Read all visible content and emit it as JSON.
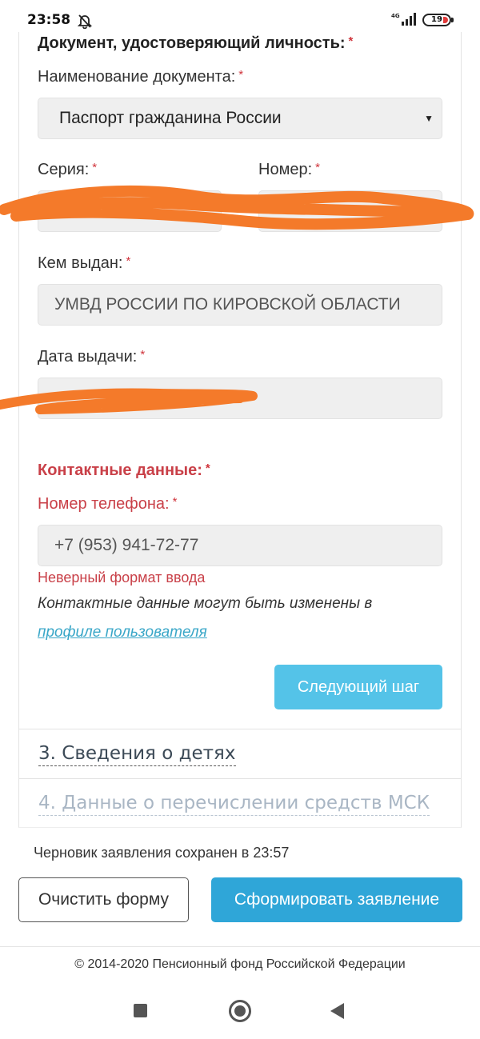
{
  "status_bar": {
    "time": "23:58",
    "network": "4G",
    "battery": "19"
  },
  "identity": {
    "section_title": "Документ, удостоверяющий личность:",
    "doc_name_label": "Наименование документа:",
    "doc_name_value": "Паспорт гражданина России",
    "series_label": "Серия:",
    "series_value": "",
    "number_label": "Номер:",
    "number_value": "",
    "issued_by_label": "Кем выдан:",
    "issued_by_value": "УМВД РОССИИ ПО КИРОВСКОЙ ОБЛАСТИ",
    "issue_date_label": "Дата выдачи:",
    "issue_date_value": ""
  },
  "contacts": {
    "section_title": "Контактные данные:",
    "phone_label": "Номер телефона:",
    "phone_value": "+7 (953) 941-72-77",
    "error": "Неверный формат ввода",
    "note": "Контактные данные могут быть изменены в",
    "note_link": "профиле пользователя",
    "next_button": "Следующий шаг"
  },
  "required_mark": "*",
  "sections": [
    {
      "label": "3. Сведения о детях"
    },
    {
      "label": "4. Данные о перечислении средств МСК"
    }
  ],
  "draft_status": "Черновик заявления сохранен в 23:57",
  "actions": {
    "clear": "Очистить форму",
    "submit": "Сформировать заявление"
  },
  "footer": {
    "copyright": "© 2014-2020 Пенсионный фонд Российской Федерации"
  },
  "colors": {
    "error_red": "#c94048",
    "primary_blue": "#2fa6d8",
    "next_blue": "#54c3e8",
    "redaction_orange": "#f47a2a"
  },
  "icons": {
    "status_mute": "bell-off-icon",
    "signal": "signal-icon",
    "battery": "battery-icon",
    "nav_recent": "square-icon",
    "nav_home": "circle-icon",
    "nav_back": "triangle-back-icon",
    "select_caret": "caret-down-icon"
  }
}
